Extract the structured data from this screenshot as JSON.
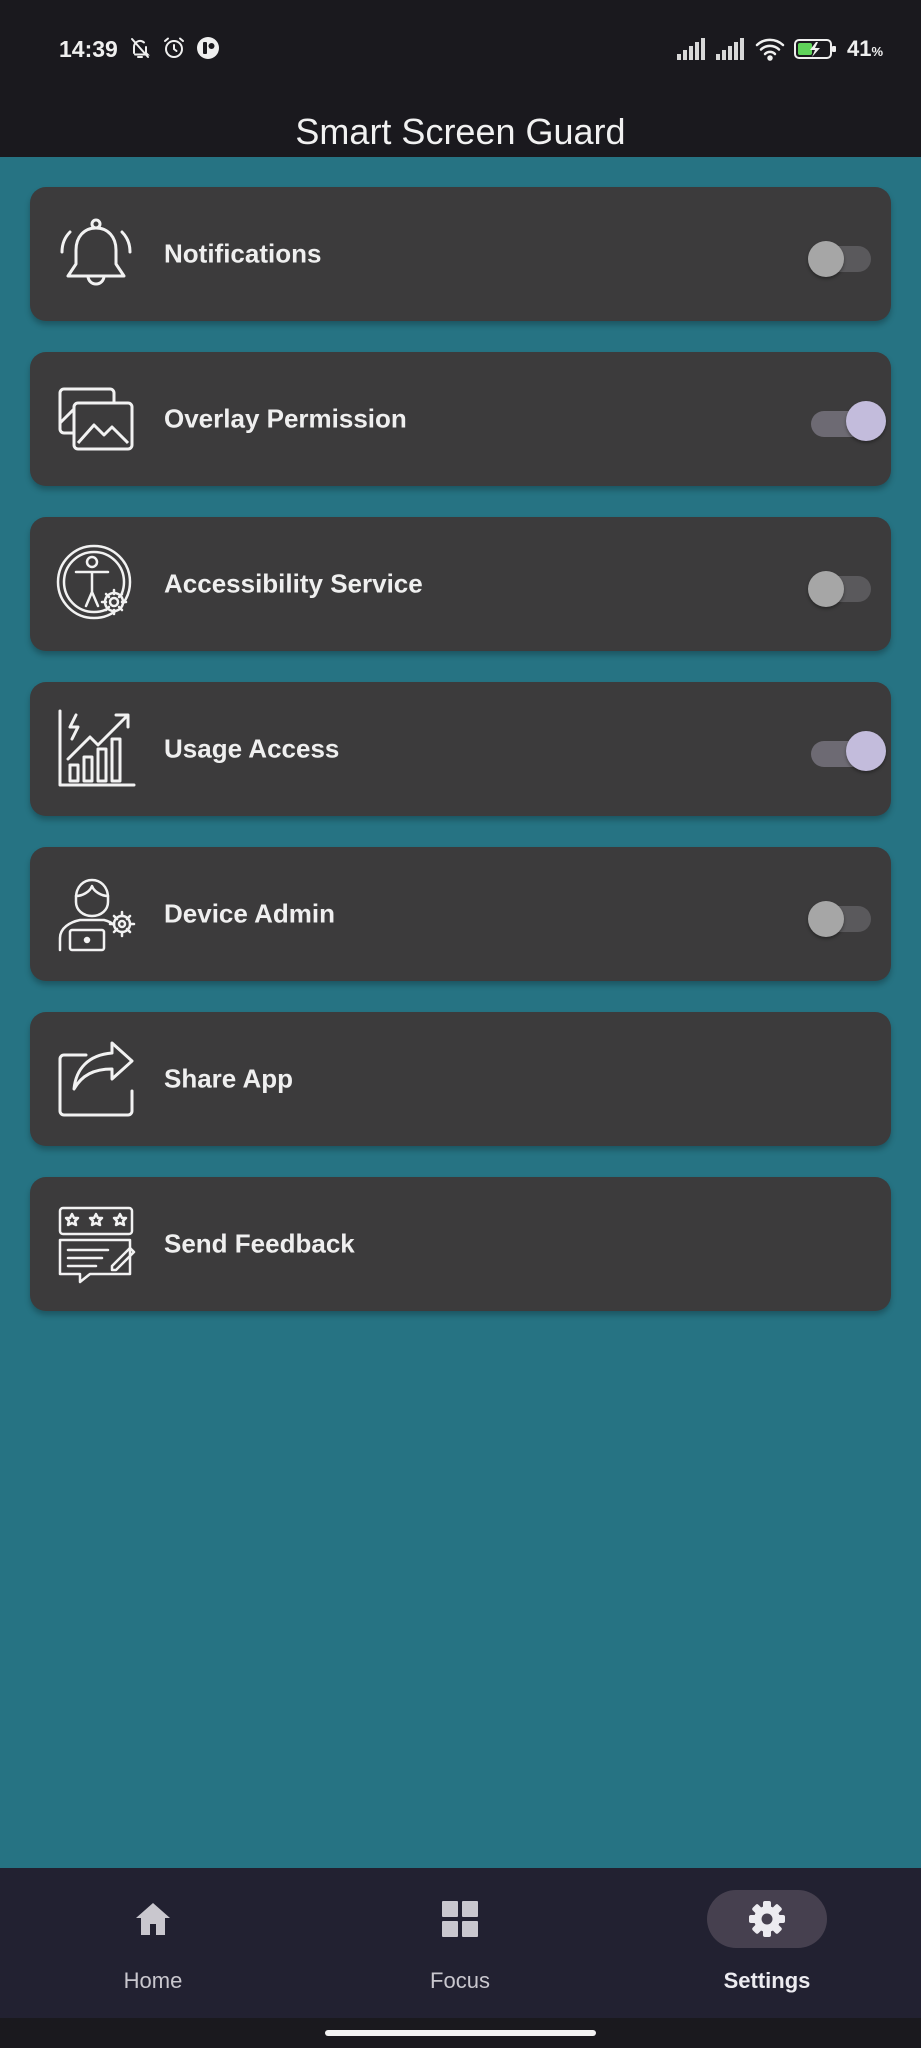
{
  "status_bar": {
    "time": "14:39",
    "battery_percent": "41",
    "battery_unit": "%",
    "left_icons": [
      "bell-off-icon",
      "alarm-icon",
      "app-badge-icon"
    ],
    "right_icons": [
      "signal-1-icon",
      "signal-2-icon",
      "wifi-icon",
      "battery-charging-icon"
    ],
    "battery_accent": "#5fd35a"
  },
  "header": {
    "title": "Smart Screen Guard"
  },
  "settings": {
    "items": [
      {
        "label": "Notifications",
        "icon": "bell-icon",
        "toggle": false
      },
      {
        "label": "Overlay Permission",
        "icon": "overlay-images-icon",
        "toggle": true
      },
      {
        "label": "Accessibility Service",
        "icon": "accessibility-icon",
        "toggle": false
      },
      {
        "label": "Usage Access",
        "icon": "usage-chart-icon",
        "toggle": true
      },
      {
        "label": "Device Admin",
        "icon": "device-admin-icon",
        "toggle": false
      },
      {
        "label": "Share App",
        "icon": "share-icon"
      },
      {
        "label": "Send Feedback",
        "icon": "feedback-icon"
      }
    ]
  },
  "bottom_nav": {
    "items": [
      {
        "label": "Home",
        "icon": "home-icon",
        "active": false
      },
      {
        "label": "Focus",
        "icon": "grid-icon",
        "active": false
      },
      {
        "label": "Settings",
        "icon": "gear-icon",
        "active": true
      }
    ]
  },
  "colors": {
    "background": "#267383",
    "card": "#3c3b3c",
    "toggle_on_thumb": "#c3bcdc",
    "toggle_off_thumb": "#a6a6a6",
    "nav_bar": "#222131"
  }
}
